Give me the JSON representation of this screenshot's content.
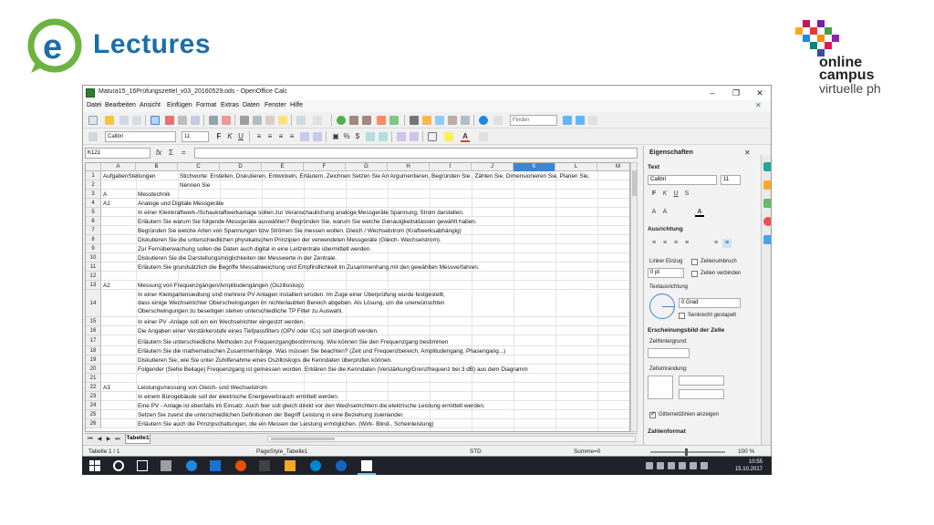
{
  "branding": {
    "electure_text": "Lectures",
    "oc_line1": "online",
    "oc_line2": "campus",
    "oc_line3": "virtuelle ph"
  },
  "window": {
    "title": "Matura15_16Prüfungszettel_v03_20160529.ods - OpenOffice Calc",
    "minimize": "–",
    "maximize": "❐",
    "close": "✕",
    "doc_close": "✕"
  },
  "menu": [
    "Datei",
    "Bearbeiten",
    "Ansicht",
    "Einfügen",
    "Format",
    "Extras",
    "Daten",
    "Fenster",
    "Hilfe"
  ],
  "toolbar": {
    "find_placeholder": "Finden",
    "font_name": "Calibri",
    "font_size": "11"
  },
  "formula": {
    "cell_ref": "K121",
    "fx": "fx",
    "sum": "Σ",
    "equals": "="
  },
  "grid": {
    "columns": [
      "A",
      "B",
      "C",
      "D",
      "E",
      "F",
      "G",
      "H",
      "I",
      "J",
      "K",
      "L",
      "M",
      "N"
    ],
    "active_column": "K",
    "rows": [
      {
        "n": "1",
        "a": "AufgabenStellungen",
        "b": "",
        "c": "Stichworte: Erstellen, Diskutieren, Entwickeln, Erläutern, Zeichnen Setzen Sie An Argumentieren, Begründen Sie , Zählen Sie, Dimensionieren Sie, Planen Sie,"
      },
      {
        "n": "2",
        "a": "",
        "b": "",
        "c": "Nennen Sie"
      },
      {
        "n": "3",
        "a": "A",
        "b": "Messtechnik",
        "c": ""
      },
      {
        "n": "4",
        "a": "A1",
        "b": "Analoge und Digitale Messgeräte",
        "c": ""
      },
      {
        "n": "5",
        "a": "",
        "b": "In einer Kleinkraftwerk-/Schaukraftwerkanlage sollen zur Veranschaulichung analoge Messgeräte Spannung, Strom darstellen.",
        "c": ""
      },
      {
        "n": "6",
        "a": "",
        "b": "Erläutern Sie warum Sie folgende Messgeräte auswählen? Begründen Sie, warum Sie welche Genauigkeitsklassen gewählt haben.",
        "c": ""
      },
      {
        "n": "7",
        "a": "",
        "b": "Begründen Sie welche Arten von Spannungen bzw Strömen Sie messen wollen. Gleich / Wechselstrom (Kraftwerksabhängig)",
        "c": ""
      },
      {
        "n": "8",
        "a": "",
        "b": "Diskutieren Sie die unterschiedlichen physikalischen Prinzipien der verwendeten Messgeräte (Gleich- Wechselstrom).",
        "c": ""
      },
      {
        "n": "9",
        "a": "",
        "b": "Zur Fernüberwachung sollen die Daten auch digital in eine Leitzentrale übermittelt werden.",
        "c": ""
      },
      {
        "n": "10",
        "a": "",
        "b": "Diskutieren Sie die Darstellungsmöglichkeiten der Messwerte in der Zentrale.",
        "c": ""
      },
      {
        "n": "11",
        "a": "",
        "b": "Erläutern Sie grundsätzlich die Begriffe Messabweichung und Empfindlichkeit im Zusammenhang mit den gewählten Messverfahren.",
        "c": ""
      },
      {
        "n": "12",
        "a": "",
        "b": "",
        "c": ""
      },
      {
        "n": "13",
        "a": "A2",
        "b": "Messung von Frequenzgängen/Amplitudengängen (Oszilloskop)",
        "c": ""
      },
      {
        "n": "14",
        "a": "",
        "b": "In einer Kleingartensiedlung sind mehrere PV Anlagen installiert wroden. Im Zuge einer Überprüfung wurde festgestellt,|dass einige Wechselrichter Oberschwingungen im nichterlaubten Bereich abgeben. Als Lösung, um die unerwünschten|Oberschwingungen zu beseitigen stehen unterschiedliche TP Filter zu Auswahl.",
        "c": ""
      },
      {
        "n": "15",
        "a": "",
        "b": "In einer PV -Anlage soll ein ein Wechselrichter eingestzt werden.",
        "c": ""
      },
      {
        "n": "16",
        "a": "",
        "b": "Die Angaben einer Verstärkerstufe eines Tiefpassfilters (OPV oder ICs) soll überprüft werden.",
        "c": ""
      },
      {
        "n": "17",
        "a": "",
        "b": "Erläutern Sie unterschiedliche Methoden zur Frequenzgangbestimmung. Wie können Sie den Frequenzgang bestimmen",
        "c": ""
      },
      {
        "n": "18",
        "a": "",
        "b": "Erläutern Sie die mathematischen Zusammenhänge. Was müssen Sie beachten? (Zeit und Frequenzbereich, Amplitudengang, Phasengang...)",
        "c": ""
      },
      {
        "n": "19",
        "a": "",
        "b": "Diskutieren Sie, wie Sie unter Zuhilfenahme eines Oszilloskops die Kenndaten überprüfen können.",
        "c": ""
      },
      {
        "n": "20",
        "a": "",
        "b": "Folgender (Siehe Beilage) Frequenzgang ist gemessen worden. Erklären Sie die Kenndaten (Verstärkung/Grenzfrequenz bei 3 dB) aus dem Diagramm",
        "c": ""
      },
      {
        "n": "21",
        "a": "",
        "b": "",
        "c": ""
      },
      {
        "n": "22",
        "a": "A3",
        "b": "Leistungsmessung von Gleich- und Wechselstrom",
        "c": ""
      },
      {
        "n": "23",
        "a": "",
        "b": "In einem Bürogebäude soll der elektrische Energieverbrauch ermittelt werden.",
        "c": ""
      },
      {
        "n": "24",
        "a": "",
        "b": "Eine PV - Anlage ist ebenfalls im Einsatz. Auch hier soll gleich direkt vor den Wechselrichtern die elektrische Leistung ermittelt werden.",
        "c": ""
      },
      {
        "n": "25",
        "a": "",
        "b": "Setzen Sie zuerst die unterschiedlichen Definitionen der Begriff Leistung in eine Beziehung zueinander.",
        "c": ""
      },
      {
        "n": "26",
        "a": "",
        "b": "Erläutern Sie auch die Prinzipschaltungen, die ein Messen der Leistung ermöglichen. (Wirk- Blind-, Scheinleistung)",
        "c": ""
      }
    ]
  },
  "sheet_tab": "Tabelle1",
  "status": {
    "sheet": "Tabelle 1 / 1",
    "page_style": "PageStyle_Tabelle1",
    "mode": "STD",
    "sum": "Summe=0",
    "zoom": "100 %"
  },
  "sidebar": {
    "title": "Eigenschaften",
    "close": "✕",
    "text_section": "Text",
    "font": "Calibri",
    "size": "11",
    "align_section": "Ausrichtung",
    "indent_label": "Linker Einzug",
    "indent_value": "0 pt",
    "wrap_label": "Zeilenumbruch",
    "merge_label": "Zellen verbinden",
    "orientation_label": "Textausrichtung",
    "angle_value": "0 Grad",
    "vertical_stack": "Senkrecht gestapelt",
    "cell_appearance": "Erscheinungsbild der Zelle",
    "background_label": "Zellhintergrund:",
    "border_label": "Zellumrandung:",
    "gridlines_label": "Gitternetzlinien anzeigen",
    "number_format": "Zahlenformat"
  },
  "taskbar": {
    "time": "10:55",
    "date": "15.10.2017"
  },
  "colors": {
    "accent": "#3d86d6",
    "brand_blue": "#1c6ea4",
    "brand_green": "#6cb33f",
    "taskbar": "#1f2228"
  }
}
